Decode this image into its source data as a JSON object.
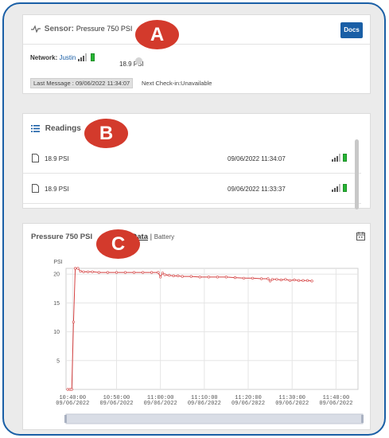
{
  "sensor": {
    "label": "Sensor:",
    "name": "Pressure 750 PSI",
    "docs_label": "Docs",
    "network_label": "Network:",
    "network_name": "Justin",
    "current_reading": "18.9 PSI",
    "last_message": "Last Message : 09/06/2022 11:34:07",
    "next_checkin": "Next Check-in:Unavailable"
  },
  "readings": {
    "title": "Readings",
    "rows": [
      {
        "value": "18.9 PSI",
        "time": "09/06/2022 11:34:07"
      },
      {
        "value": "18.9 PSI",
        "time": "09/06/2022 11:33:37"
      }
    ]
  },
  "chart_panel": {
    "title": "Pressure 750 PSI",
    "tab_data": "Data",
    "separator": "|",
    "tab_battery": "Battery"
  },
  "markers": {
    "a": "A",
    "b": "B",
    "c": "C"
  },
  "colors": {
    "accent": "#1a5fa6",
    "marker": "#d33a2c",
    "battery": "#27b534",
    "series": "#d44040"
  },
  "chart_data": {
    "type": "line",
    "ylabel": "PSI",
    "ylim": [
      0,
      21
    ],
    "yticks": [
      5,
      10,
      15,
      20
    ],
    "x_tick_times": [
      "10:40:00",
      "10:50:00",
      "11:00:00",
      "11:10:00",
      "11:20:00",
      "11:30:00",
      "11:40:00"
    ],
    "x_tick_dates": [
      "09/06/2022",
      "09/06/2022",
      "09/06/2022",
      "09/06/2022",
      "09/06/2022",
      "09/06/2022",
      "09/06/2022"
    ],
    "x_tick_minutes": [
      40,
      50,
      60,
      70,
      80,
      90,
      100
    ],
    "xlim": [
      38.5,
      105
    ],
    "series": [
      {
        "points": [
          [
            38.9,
            0
          ],
          [
            39.4,
            0
          ],
          [
            39.8,
            0
          ],
          [
            40.2,
            11.7
          ],
          [
            40.6,
            21
          ],
          [
            41.2,
            21
          ],
          [
            41.8,
            20.5
          ],
          [
            42.5,
            20.4
          ],
          [
            43.5,
            20.4
          ],
          [
            44.5,
            20.4
          ],
          [
            46,
            20.3
          ],
          [
            48,
            20.3
          ],
          [
            50,
            20.3
          ],
          [
            52,
            20.3
          ],
          [
            54,
            20.3
          ],
          [
            56,
            20.3
          ],
          [
            58,
            20.3
          ],
          [
            59.5,
            20.3
          ],
          [
            60,
            19.5
          ],
          [
            60.5,
            20.2
          ],
          [
            61,
            19.9
          ],
          [
            62,
            19.8
          ],
          [
            63,
            19.7
          ],
          [
            64,
            19.7
          ],
          [
            65,
            19.6
          ],
          [
            67,
            19.6
          ],
          [
            69,
            19.5
          ],
          [
            71,
            19.5
          ],
          [
            73,
            19.5
          ],
          [
            75,
            19.5
          ],
          [
            77,
            19.4
          ],
          [
            79,
            19.3
          ],
          [
            81,
            19.3
          ],
          [
            83,
            19.2
          ],
          [
            84.5,
            19.2
          ],
          [
            85,
            18.8
          ],
          [
            85.5,
            19.1
          ],
          [
            86.5,
            19.1
          ],
          [
            87.5,
            19.0
          ],
          [
            88.5,
            19.1
          ],
          [
            89.5,
            18.9
          ],
          [
            90.5,
            19.0
          ],
          [
            91.5,
            18.9
          ],
          [
            92.5,
            18.9
          ],
          [
            93.5,
            18.9
          ],
          [
            94.5,
            18.8
          ]
        ]
      }
    ]
  }
}
